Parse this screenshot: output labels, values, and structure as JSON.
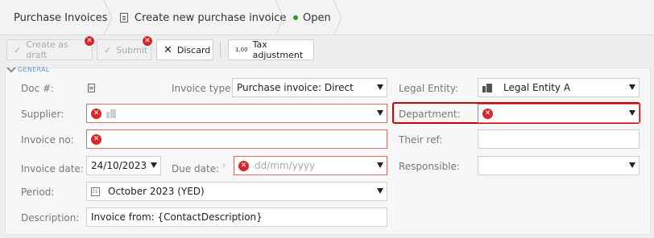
{
  "breadcrumb": {
    "items": [
      "Purchase Invoices",
      "Create new purchase invoice"
    ],
    "status": "Open"
  },
  "toolbar": {
    "create_draft": "Create as draft",
    "submit": "Submit",
    "discard": "Discard",
    "tax_adjustment": "Tax adjustment",
    "tax_icon_text": "1,00"
  },
  "section": {
    "title": "GENERAL"
  },
  "form": {
    "doc_no_label": "Doc #:",
    "invoice_type_label": "Invoice type:",
    "invoice_type_value": "Purchase invoice: Direct",
    "legal_entity_label": "Legal Entity:",
    "legal_entity_value": "Legal Entity A",
    "supplier_label": "Supplier:",
    "supplier_value": "",
    "department_label": "Department:",
    "department_value": "",
    "invoice_no_label": "Invoice no:",
    "invoice_no_value": "",
    "their_ref_label": "Their ref:",
    "their_ref_value": "",
    "invoice_date_label": "Invoice date:",
    "invoice_date_value": "24/10/2023",
    "due_date_label": "Due date:",
    "due_date_placeholder": "dd/mm/yyyy",
    "responsible_label": "Responsible:",
    "responsible_value": "",
    "period_label": "Period:",
    "period_value": "October 2023 (YED)",
    "description_label": "Description:",
    "description_value": "Invoice from: {ContactDescription}",
    "hint_mark": "?"
  },
  "colors": {
    "error": "#d9262c",
    "section_accent": "#5b9bd5",
    "status_open": "#2ca02c",
    "focus_border": "#cc0000"
  }
}
